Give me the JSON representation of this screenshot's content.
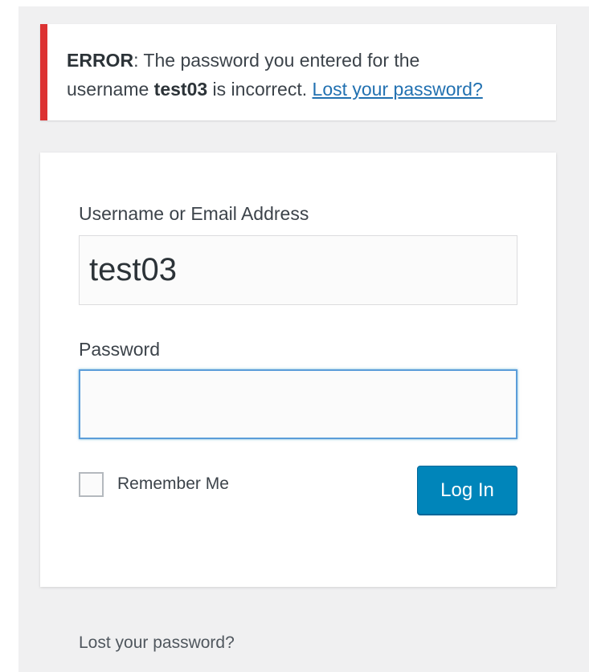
{
  "error": {
    "prefix": "ERROR",
    "text_1": ": The password you entered for the",
    "text_2": "username ",
    "username": "test03",
    "text_3": " is incorrect. ",
    "link": "Lost your password?"
  },
  "form": {
    "username_label": "Username or Email Address",
    "username_value": "test03",
    "password_label": "Password",
    "password_value": "",
    "remember_label": "Remember Me",
    "login_button": "Log In"
  },
  "footer": {
    "lost_password": "Lost your password?"
  },
  "colors": {
    "error_border": "#dc3232",
    "link": "#2271b1",
    "primary_button": "#0085ba",
    "focus_border": "#5b9dd9"
  }
}
